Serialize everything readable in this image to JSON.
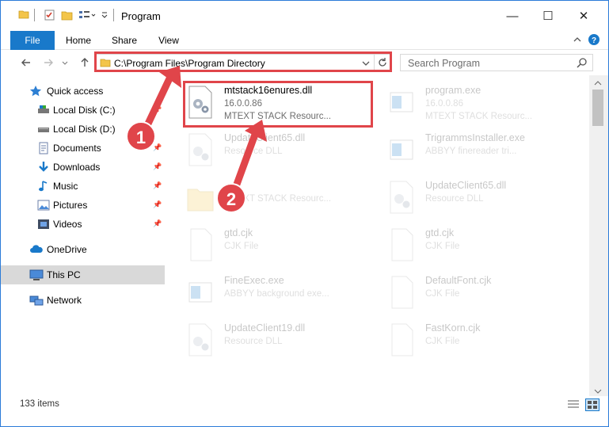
{
  "window": {
    "title": "Program",
    "minimize_glyph": "—",
    "maximize_glyph": "☐",
    "close_glyph": "✕"
  },
  "ribbon": {
    "tabs": [
      {
        "label": "File"
      },
      {
        "label": "Home"
      },
      {
        "label": "Share"
      },
      {
        "label": "View"
      }
    ]
  },
  "address": {
    "path": "C:\\Program Files\\Program Directory"
  },
  "search": {
    "placeholder": "Search Program"
  },
  "sidebar": {
    "items": [
      {
        "label": "Quick access",
        "icon": "star-icon"
      },
      {
        "label": "Local Disk (C:)",
        "icon": "drive-icon"
      },
      {
        "label": "Local Disk (D:)",
        "icon": "drive-icon"
      },
      {
        "label": "Documents",
        "icon": "documents-icon"
      },
      {
        "label": "Downloads",
        "icon": "downloads-icon"
      },
      {
        "label": "Music",
        "icon": "music-icon"
      },
      {
        "label": "Pictures",
        "icon": "pictures-icon"
      },
      {
        "label": "Videos",
        "icon": "videos-icon"
      },
      {
        "label": "OneDrive",
        "icon": "cloud-icon"
      },
      {
        "label": "This PC",
        "icon": "computer-icon"
      },
      {
        "label": "Network",
        "icon": "network-icon"
      }
    ]
  },
  "files": [
    {
      "name": "mtstack16enures.dll",
      "line2": "16.0.0.86",
      "line3": "MTEXT STACK Resourc..."
    },
    {
      "name": "program.exe",
      "line2": "16.0.0.86",
      "line3": "MTEXT STACK Resourc..."
    },
    {
      "name": "UpdateClient65.dll",
      "line2": "Resource DLL",
      "line3": ""
    },
    {
      "name": "TrigrammsInstaller.exe",
      "line2": "ABBYY finereader tri...",
      "line3": ""
    },
    {
      "name": "",
      "line2": "MTEXT STACK Resourc...",
      "line3": ""
    },
    {
      "name": "UpdateClient65.dll",
      "line2": "Resource DLL",
      "line3": ""
    },
    {
      "name": "gtd.cjk",
      "line2": "CJK File",
      "line3": ""
    },
    {
      "name": "gtd.cjk",
      "line2": "CJK File",
      "line3": ""
    },
    {
      "name": "FineExec.exe",
      "line2": "ABBYY background exe...",
      "line3": ""
    },
    {
      "name": "DefaultFont.cjk",
      "line2": "CJK File",
      "line3": ""
    },
    {
      "name": "UpdateClient19.dll",
      "line2": "Resource DLL",
      "line3": ""
    },
    {
      "name": "FastKorn.cjk",
      "line2": "CJK File",
      "line3": ""
    }
  ],
  "status": {
    "item_count": "133 items"
  },
  "annotations": {
    "step1": "1",
    "step2": "2",
    "color": "#e0454a"
  }
}
